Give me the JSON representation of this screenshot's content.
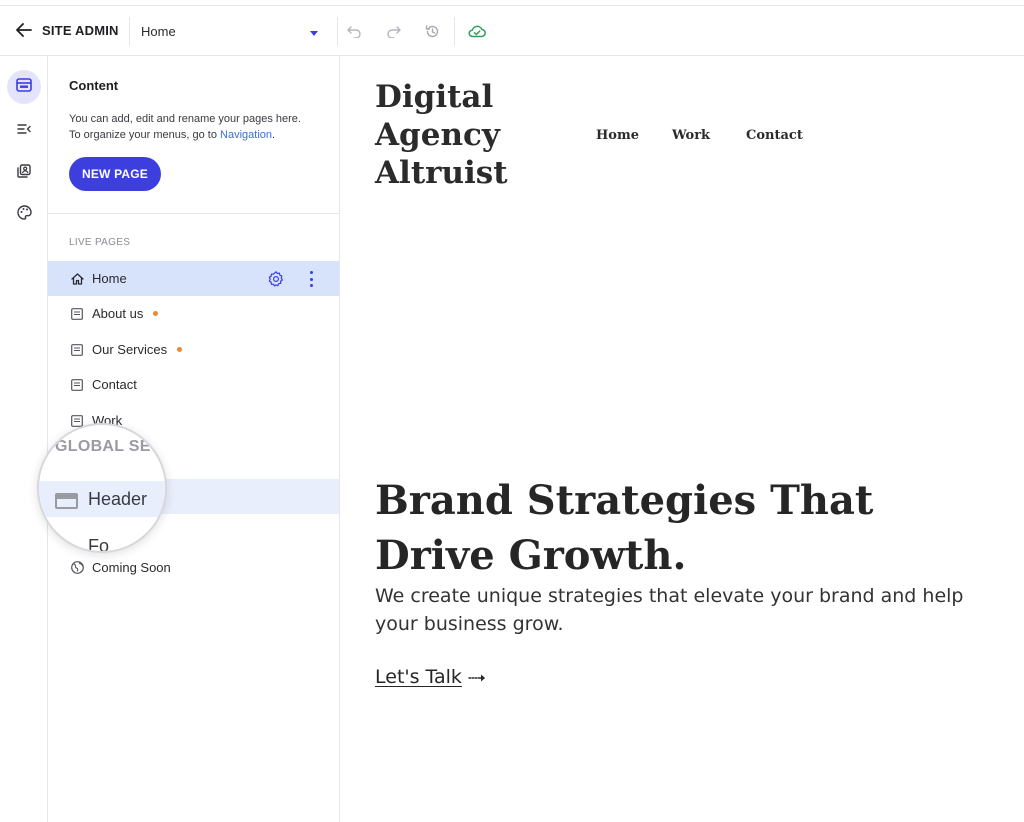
{
  "topbar": {
    "back_label": "SITE ADMIN",
    "page_select_value": "Home"
  },
  "panel": {
    "title": "Content",
    "description_line1": "You can add, edit and rename your pages here.",
    "description_line2_prefix": "To organize your menus, go to ",
    "description_link": "Navigation",
    "description_line2_suffix": ".",
    "new_page_label": "NEW PAGE",
    "live_pages_label": "LIVE PAGES",
    "pages": [
      {
        "label": "Home",
        "selected": true
      },
      {
        "label": "About us",
        "unsaved_dot": true
      },
      {
        "label": "Our Services",
        "unsaved_dot": true
      },
      {
        "label": "Contact"
      },
      {
        "label": "Work"
      }
    ],
    "global_sections_label": "GLOBAL SEC",
    "global_sections": [
      {
        "label": "Header",
        "highlighted": true
      },
      {
        "label": "Fo"
      },
      {
        "label": "Coming Soon"
      }
    ]
  },
  "preview": {
    "logo_lines": [
      "Digital",
      "Agency",
      "Altruist"
    ],
    "nav": [
      "Home",
      "Work",
      "Contact"
    ],
    "hero_title_line1": "Brand Strategies That",
    "hero_title_line2": "Drive Growth.",
    "hero_subtitle": "We create unique strategies that elevate your brand and help your business grow.",
    "cta_label": "Let's Talk"
  },
  "colors": {
    "accent": "#3c3fde",
    "selected_row": "#d7e2fb",
    "rail_active": "#e3e4fb",
    "unsaved_dot": "#ea8a2e",
    "link": "#3b6fd1",
    "cloud_saved": "#2e9e5b"
  },
  "icons": {
    "back": "arrow-left-icon",
    "dropdown": "caret-down-icon",
    "undo": "undo-icon",
    "redo": "redo-icon",
    "history": "history-icon",
    "saved": "cloud-check-icon",
    "rail": [
      "pages-icon",
      "navigation-icon",
      "library-icon",
      "palette-icon"
    ],
    "home": "home-icon",
    "page": "page-icon",
    "settings": "gear-icon",
    "more": "kebab-icon",
    "header": "header-section-icon",
    "globe": "globe-icon",
    "cta_arrow": "dotted-arrow-right-icon"
  }
}
